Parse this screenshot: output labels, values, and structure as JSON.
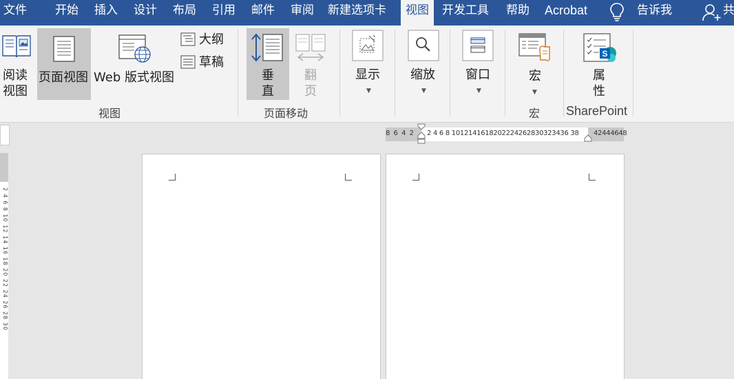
{
  "tabs": {
    "file": "文件",
    "home": "开始",
    "insert": "插入",
    "design": "设计",
    "layout": "布局",
    "references": "引用",
    "mailings": "邮件",
    "review": "审阅",
    "new_tab": "新建选项卡",
    "view": "视图",
    "developer": "开发工具",
    "help": "帮助",
    "acrobat": "Acrobat",
    "tell_me": "告诉我",
    "share": "共"
  },
  "active_tab": "view",
  "ribbon": {
    "views": {
      "label": "视图",
      "read_mode": [
        "阅读",
        "视图"
      ],
      "print_layout": "页面视图",
      "web_layout": "Web 版式视图",
      "outline": "大纲",
      "draft": "草稿"
    },
    "page_movement": {
      "label": "页面移动",
      "vertical": [
        "垂",
        "直"
      ],
      "side_to_side": [
        "翻",
        "页"
      ]
    },
    "show": {
      "label": "显示"
    },
    "zoom": {
      "label": "缩放"
    },
    "window": {
      "label": "窗口"
    },
    "macros": {
      "group_label": "宏",
      "button": "宏"
    },
    "sharepoint": {
      "group_label": "SharePoint",
      "properties": [
        "属",
        "性"
      ]
    }
  },
  "ruler": {
    "left_numbers": "8 6 4 2",
    "right_numbers": "2  4  6  8 1012141618202224262830323436 38",
    "far_numbers": "42444648",
    "vertical_numbers": "2 4 6 8 10 12 14 16 18 20 22 24 26 28 30"
  },
  "colors": {
    "tab_bar": "#2b579a",
    "ribbon_bg": "#f3f3f3",
    "workspace": "#e6e6e6",
    "selected_button": "#c8c8c8",
    "sharepoint_blue": "#0364b8"
  }
}
